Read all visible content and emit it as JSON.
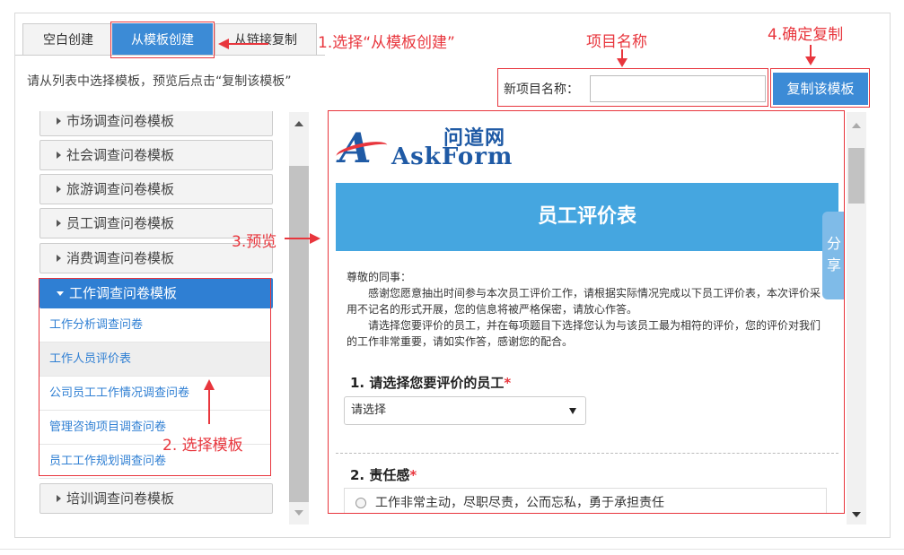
{
  "tabs": [
    {
      "label": "空白创建"
    },
    {
      "label": "从模板创建"
    },
    {
      "label": "从链接复制"
    }
  ],
  "instruction": "请从列表中选择模板，预览后点击“复制该模板”",
  "new_project": {
    "label": "新项目名称：",
    "value": "",
    "copy_button": "复制该模板"
  },
  "categories": [
    {
      "label": "市场调查问卷模板"
    },
    {
      "label": "社会调查问卷模板"
    },
    {
      "label": "旅游调查问卷模板"
    },
    {
      "label": "员工调查问卷模板"
    },
    {
      "label": "消费调查问卷模板"
    },
    {
      "label": "工作调查问卷模板"
    },
    {
      "label": "培训调查问卷模板"
    }
  ],
  "active_category_items": [
    {
      "label": "工作分析调查问卷"
    },
    {
      "label": "工作人员评价表"
    },
    {
      "label": "公司员工工作情况调查问卷"
    },
    {
      "label": "管理咨询项目调查问卷"
    },
    {
      "label": "员工工作规划调查问卷"
    }
  ],
  "annotations": {
    "step1": "1.选择“从模板创建”",
    "project_name": "项目名称",
    "step4": "4.确定复制",
    "step3": "3.预览",
    "step2": "2. 选择模板"
  },
  "preview": {
    "logo_cn": "问道网",
    "logo_en": "AskForm",
    "form_title": "员工评价表",
    "share": "分享",
    "intro_greeting": "尊敬的同事：",
    "intro_p1": "感谢您愿意抽出时间参与本次员工评价工作，请根据实际情况完成以下员工评价表，本次评价采用不记名的形式开展，您的信息将被严格保密，请放心作答。",
    "intro_p2": "请选择您要评价的员工，并在每项题目下选择您认为与该员工最为相符的评价，您的评价对我们的工作非常重要，请如实作答，感谢您的配合。",
    "q1_title": "1. 请选择您要评价的员工",
    "q1_select": "请选择",
    "q2_title": "2. 责任感",
    "q2_option1": "工作非常主动，尽职尽责，公而忘私，勇于承担责任",
    "required_mark": "*"
  },
  "colors": {
    "accent_blue": "#3c8bd6",
    "annotation_red": "#e8363d",
    "form_header_blue": "#45a6e0"
  }
}
